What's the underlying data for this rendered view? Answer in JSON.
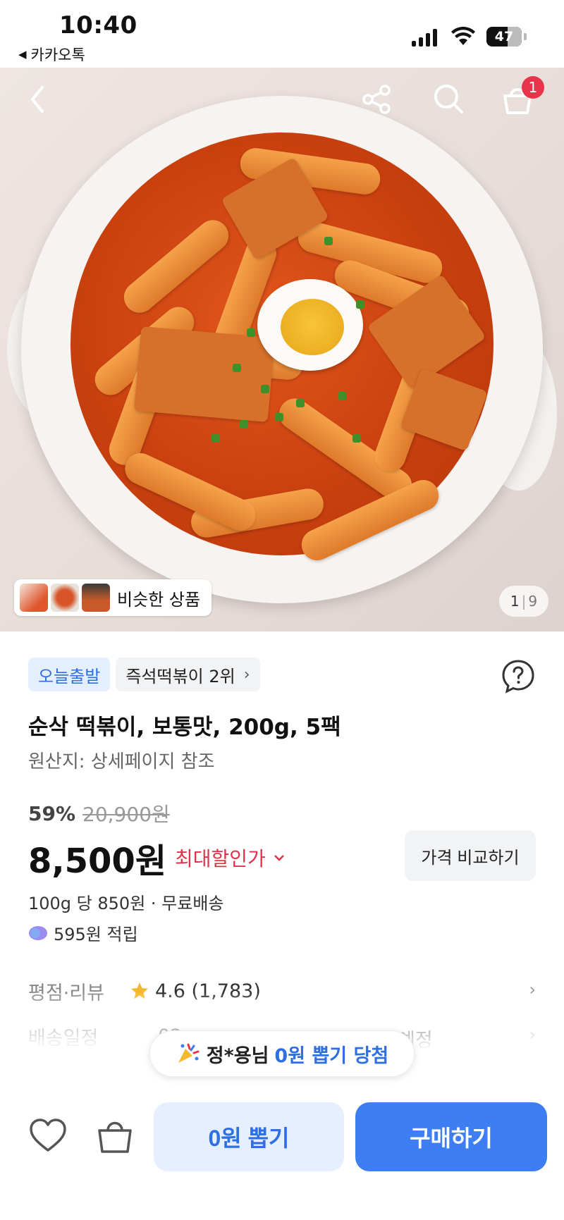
{
  "status_bar": {
    "time": "10:40",
    "back_app": "카카오톡",
    "battery": "47"
  },
  "hero": {
    "similar_label": "비슷한 상품",
    "pager_current": "1",
    "pager_total": "9",
    "cart_count": "1"
  },
  "product": {
    "tags": [
      "오늘출발",
      "즉석떡볶이 2위"
    ],
    "title": "순삭 떡볶이, 보통맛, 200g, 5팩",
    "origin": "원산지: 상세페이지 참조",
    "discount_rate": "59%",
    "original_price": "20,900원",
    "price": "8,500원",
    "max_discount_label": "최대할인가",
    "compare_button": "가격 비교하기",
    "unit_price": "100g 당 850원 · 무료배송",
    "points": "595원 적립"
  },
  "info_rows": [
    {
      "key": "평점·리뷰",
      "value": "4.6 (1,783)"
    },
    {
      "key": "배송일정",
      "value": "02"
    },
    {
      "value_end": "예정"
    }
  ],
  "toast": {
    "prefix": "정*용님",
    "highlight": "0원 뽑기 당첨"
  },
  "bottom_bar": {
    "zero_button": "0원 뽑기",
    "buy_button": "구매하기"
  },
  "colors": {
    "accent_blue": "#3d7ef2",
    "discount_red": "#e0324a",
    "badge_red": "#e8344a",
    "star": "#f5b82e"
  }
}
